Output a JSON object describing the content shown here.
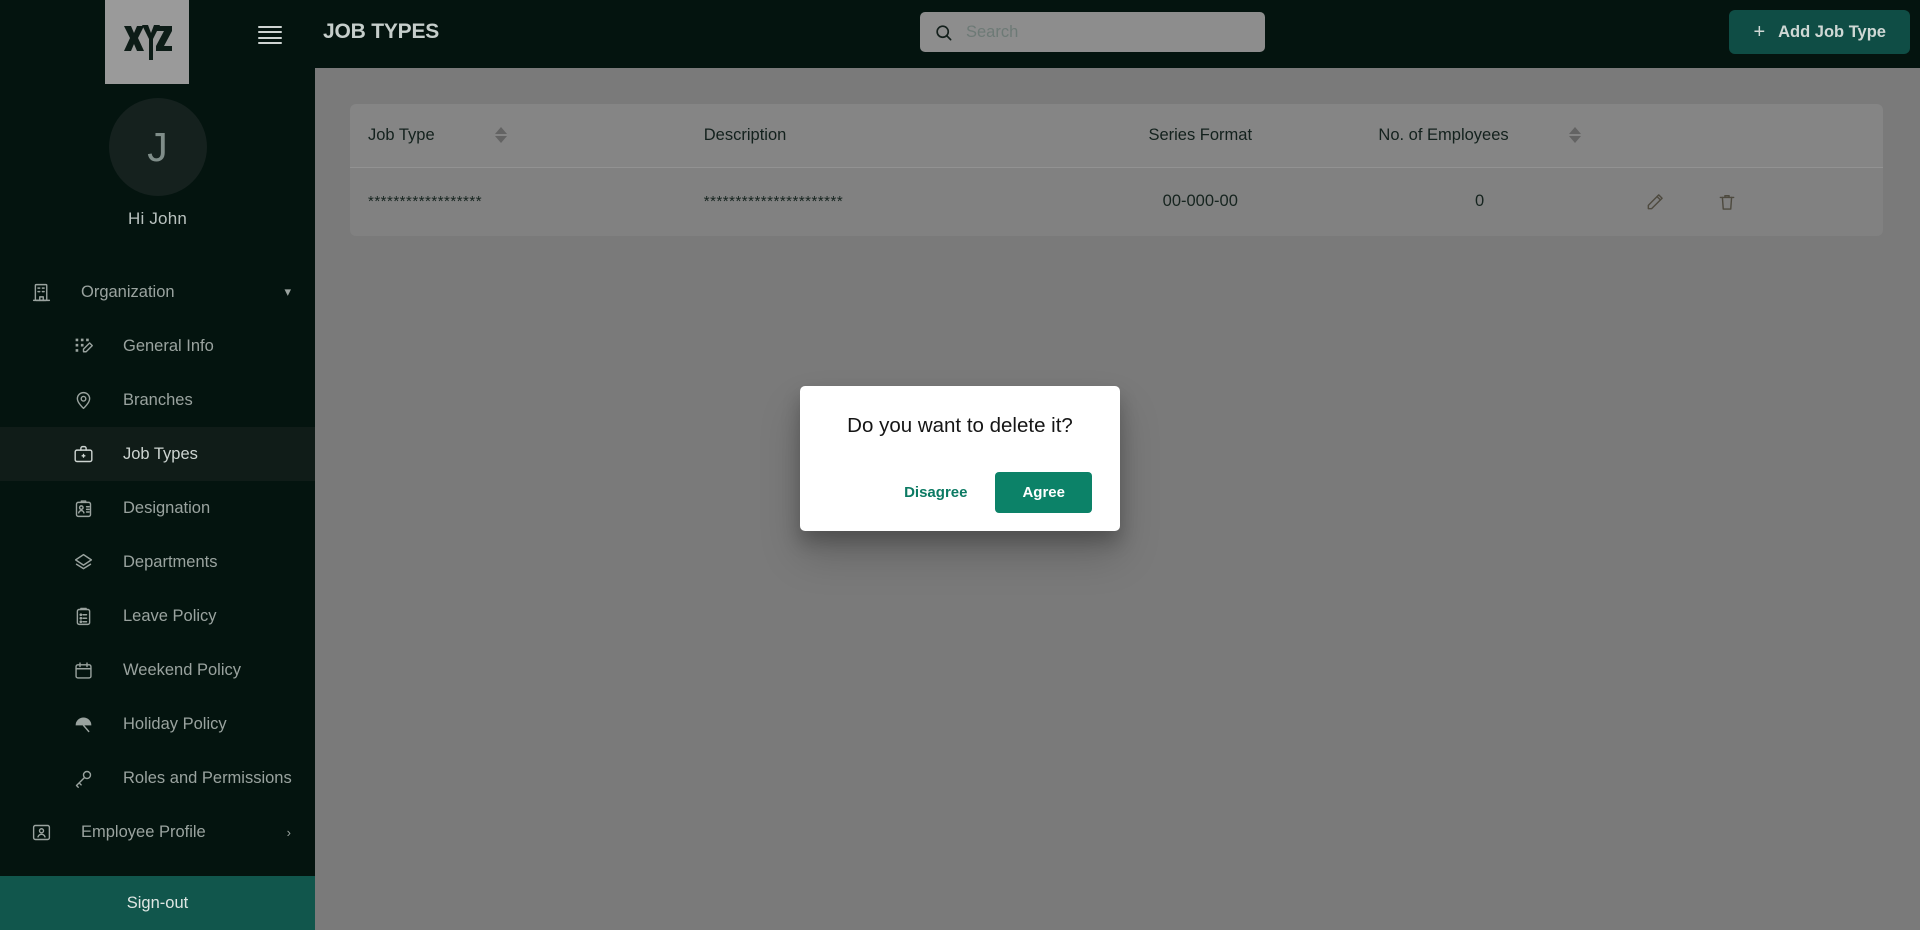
{
  "sidebar": {
    "logo_alt": "XYZ",
    "avatar_initial": "J",
    "greeting": "Hi John",
    "items": [
      {
        "label": "Organization",
        "icon": "building-icon",
        "level": 0,
        "active": false,
        "chevron": "chevron-down"
      },
      {
        "label": "General Info",
        "icon": "grid-edit-icon",
        "level": 1,
        "active": false,
        "chevron": ""
      },
      {
        "label": "Branches",
        "icon": "map-pin-icon",
        "level": 1,
        "active": false,
        "chevron": ""
      },
      {
        "label": "Job Types",
        "icon": "briefcase-icon",
        "level": 1,
        "active": true,
        "chevron": ""
      },
      {
        "label": "Designation",
        "icon": "id-badge-icon",
        "level": 1,
        "active": false,
        "chevron": ""
      },
      {
        "label": "Departments",
        "icon": "layers-icon",
        "level": 1,
        "active": false,
        "chevron": ""
      },
      {
        "label": "Leave Policy",
        "icon": "clipboard-icon",
        "level": 1,
        "active": false,
        "chevron": ""
      },
      {
        "label": "Weekend Policy",
        "icon": "calendar-icon",
        "level": 1,
        "active": false,
        "chevron": ""
      },
      {
        "label": "Holiday Policy",
        "icon": "umbrella-icon",
        "level": 1,
        "active": false,
        "chevron": ""
      },
      {
        "label": "Roles and Permissions",
        "icon": "key-icon",
        "level": 1,
        "active": false,
        "chevron": ""
      },
      {
        "label": "Employee Profile",
        "icon": "contact-card-icon",
        "level": 0,
        "active": false,
        "chevron": "chevron-right"
      }
    ],
    "signout_label": "Sign-out"
  },
  "header": {
    "title": "JOB TYPES",
    "menu_icon": "hamburger-icon",
    "search": {
      "icon": "search-icon",
      "placeholder": "Search",
      "value": ""
    },
    "add_button": {
      "label": "Add Job Type",
      "icon": "plus-icon"
    }
  },
  "table": {
    "columns": [
      {
        "label": "Job Type",
        "sortable": true
      },
      {
        "label": "Description",
        "sortable": false
      },
      {
        "label": "Series Format",
        "sortable": false
      },
      {
        "label": "No. of Employees",
        "sortable": true
      },
      {
        "label": "",
        "sortable": false
      }
    ],
    "rows": [
      {
        "job_type": "******************",
        "description": "**********************",
        "series_format": "00-000-00",
        "employees": "0",
        "edit_icon": "pencil-icon",
        "delete_icon": "trash-icon"
      }
    ]
  },
  "dialog": {
    "title": "Do you want to delete it?",
    "disagree_label": "Disagree",
    "agree_label": "Agree"
  },
  "colors": {
    "sidebar_bg": "#04140f",
    "accent_teal": "#0c8268",
    "signout_bg": "#11564c",
    "add_button_bg": "#0f4d45",
    "content_bg": "#7a7a7a"
  }
}
